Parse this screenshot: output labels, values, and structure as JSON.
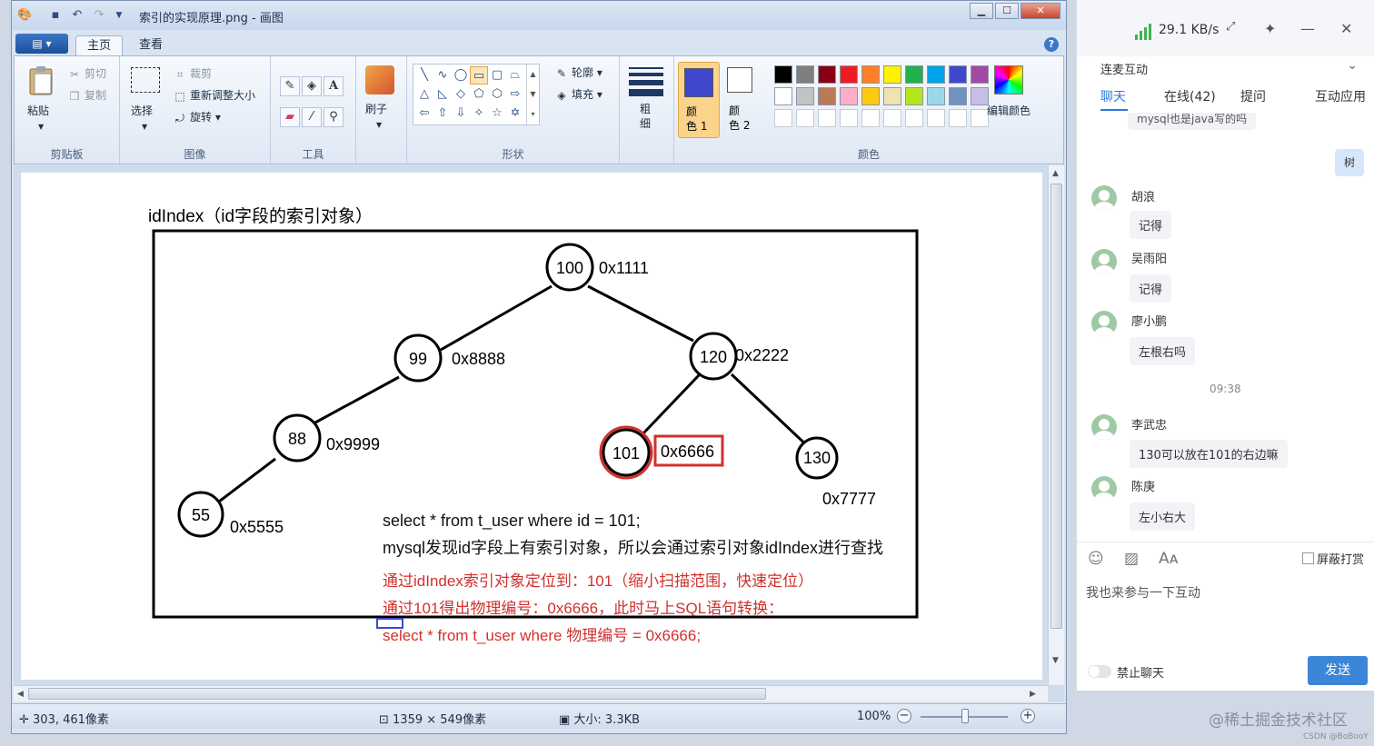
{
  "paint": {
    "title": "索引的实现原理.png - 画图",
    "tabs": [
      "主页",
      "查看"
    ],
    "groups": {
      "clipboard": {
        "label": "剪贴板",
        "paste": "粘贴",
        "cut": "剪切",
        "copy": "复制"
      },
      "image": {
        "label": "图像",
        "select": "选择",
        "crop": "裁剪",
        "resize": "重新调整大小",
        "rotate": "旋转"
      },
      "tools": {
        "label": "工具"
      },
      "brushes": {
        "label": "刷子"
      },
      "shapes": {
        "label": "形状",
        "outline": "轮廓",
        "fill": "填充"
      },
      "size": {
        "label": "粗\n细"
      },
      "colors": {
        "label": "颜色",
        "color1": "颜\n色 1",
        "color2": "颜\n色 2",
        "edit": "编辑颜色"
      }
    },
    "palette_colors": [
      "#000000",
      "#7f7f7f",
      "#880015",
      "#ed1c24",
      "#ff7f27",
      "#fff200",
      "#22b14c",
      "#00a2e8",
      "#3f48cc",
      "#a349a4",
      "#ffffff",
      "#c3c3c3",
      "#b97a57",
      "#ffaec9",
      "#ffc90e",
      "#efe4b0",
      "#b5e61d",
      "#99d9ea",
      "#7092be",
      "#c8bfe7"
    ],
    "color1": "#3f48cc",
    "color2": "#ffffff",
    "status": {
      "cursor": "303, 461像素",
      "dimensions": "1359 × 549像素",
      "size": "大小: 3.3KB",
      "zoom": "100%"
    }
  },
  "diagram": {
    "heading": "idIndex（id字段的索引对象）",
    "nodes": [
      {
        "key": "100",
        "addr": "0x1111"
      },
      {
        "key": "99",
        "addr": "0x8888"
      },
      {
        "key": "120",
        "addr": "0x2222"
      },
      {
        "key": "88",
        "addr": "0x9999"
      },
      {
        "key": "101",
        "addr": "0x6666"
      },
      {
        "key": "130",
        "addr": "0x7777"
      },
      {
        "key": "55",
        "addr": "0x5555"
      }
    ],
    "lines": [
      "select * from t_user where id = 101;",
      "mysql发现id字段上有索引对象，所以会通过索引对象idIndex进行查找",
      "通过idIndex索引对象定位到：101（缩小扫描范围，快速定位）",
      "通过101得出物理编号：0x6666，此时马上SQL语句转换：",
      "select * from t_user where 物理编号 = 0x6666;"
    ]
  },
  "chat": {
    "speed": "29.1 KB/s",
    "mode": "连麦互动",
    "tabs": [
      "聊天",
      "在线(42)",
      "提问",
      "互动应用"
    ],
    "top_message": "mysql也是java写的吗",
    "my_message": "树",
    "messages": [
      {
        "name": "胡浪",
        "text": "记得"
      },
      {
        "name": "吴雨阳",
        "text": "记得"
      },
      {
        "name": "廖小鹏",
        "text": "左根右吗"
      },
      {
        "name": "李武忠",
        "text": "130可以放在101的右边嘛"
      },
      {
        "name": "陈庚",
        "text": "左小右大"
      }
    ],
    "time": "09:38",
    "block_label": "屏蔽打赏",
    "input_text": "我也来参与一下互动",
    "ban_label": "禁止聊天",
    "send": "发送"
  },
  "watermark": "@稀土掘金技术社区",
  "watermark_small": "CSDN @BoBooY"
}
